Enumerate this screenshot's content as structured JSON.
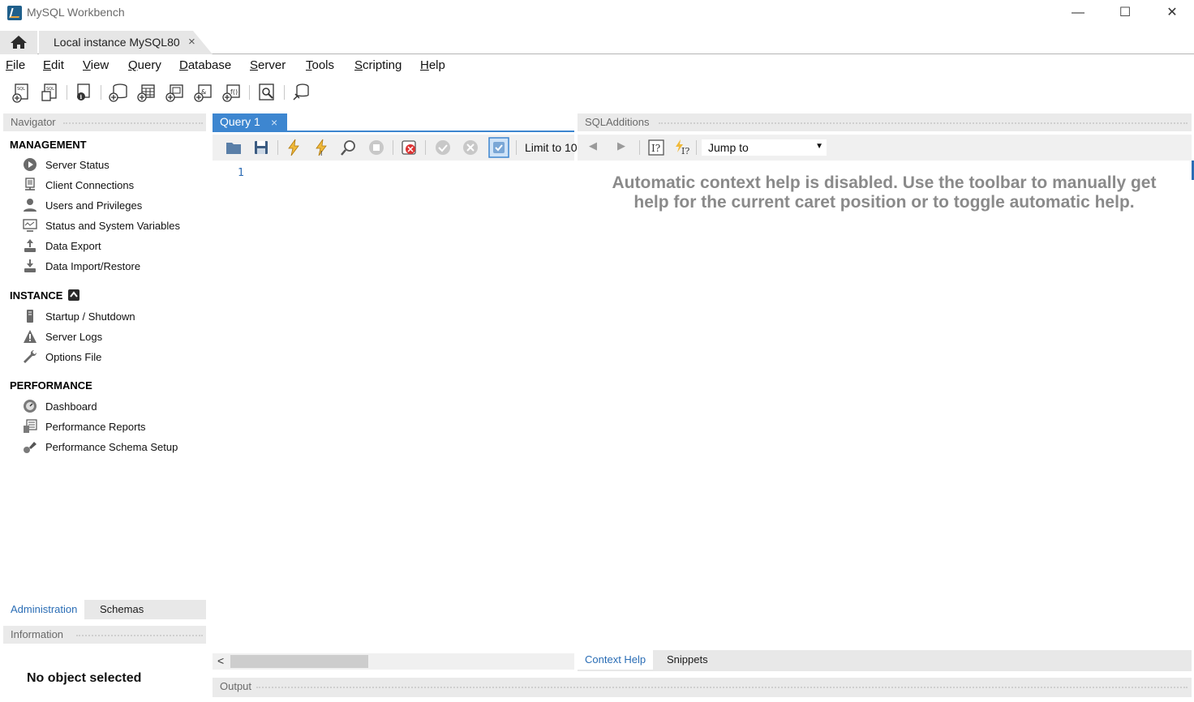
{
  "window": {
    "title": "MySQL Workbench",
    "minimize": "—",
    "maximize": "☐",
    "close": "✕"
  },
  "tabs": {
    "instance_tab": "Local instance MySQL80",
    "instance_tab_close": "×"
  },
  "menu": {
    "items": [
      {
        "accel": "F",
        "rest": "ile"
      },
      {
        "accel": "E",
        "rest": "dit"
      },
      {
        "accel": "V",
        "rest": "iew"
      },
      {
        "accel": "Q",
        "rest": "uery"
      },
      {
        "accel": "D",
        "rest": "atabase"
      },
      {
        "accel": "S",
        "rest": "erver"
      },
      {
        "accel": "T",
        "rest": "ools"
      },
      {
        "accel": "S",
        "rest": "cripting"
      },
      {
        "accel": "H",
        "rest": "elp"
      }
    ]
  },
  "navigator": {
    "header": "Navigator",
    "management": {
      "title": "MANAGEMENT",
      "items": [
        "Server Status",
        "Client Connections",
        "Users and Privileges",
        "Status and System Variables",
        "Data Export",
        "Data Import/Restore"
      ]
    },
    "instance": {
      "title": "INSTANCE",
      "items": [
        "Startup / Shutdown",
        "Server Logs",
        "Options File"
      ]
    },
    "performance": {
      "title": "PERFORMANCE",
      "items": [
        "Dashboard",
        "Performance Reports",
        "Performance Schema Setup"
      ]
    },
    "tabs": {
      "administration": "Administration",
      "schemas": "Schemas"
    }
  },
  "information": {
    "header": "Information",
    "text": "No object selected"
  },
  "query": {
    "tab_label": "Query 1",
    "tab_close": "×",
    "limit_label": "Limit to 10",
    "line_number": "1"
  },
  "sql_additions": {
    "header": "SQLAdditions",
    "jump_to": "Jump to",
    "help_text": "Automatic context help is disabled. Use the toolbar to manually get help for the current caret position or to toggle automatic help.",
    "tabs": {
      "context_help": "Context Help",
      "snippets": "Snippets"
    }
  },
  "output": {
    "header": "Output"
  },
  "colors": {
    "accent": "#3d86d0",
    "panel_bg": "#eaeaea",
    "help_text": "#8a8a8a"
  }
}
